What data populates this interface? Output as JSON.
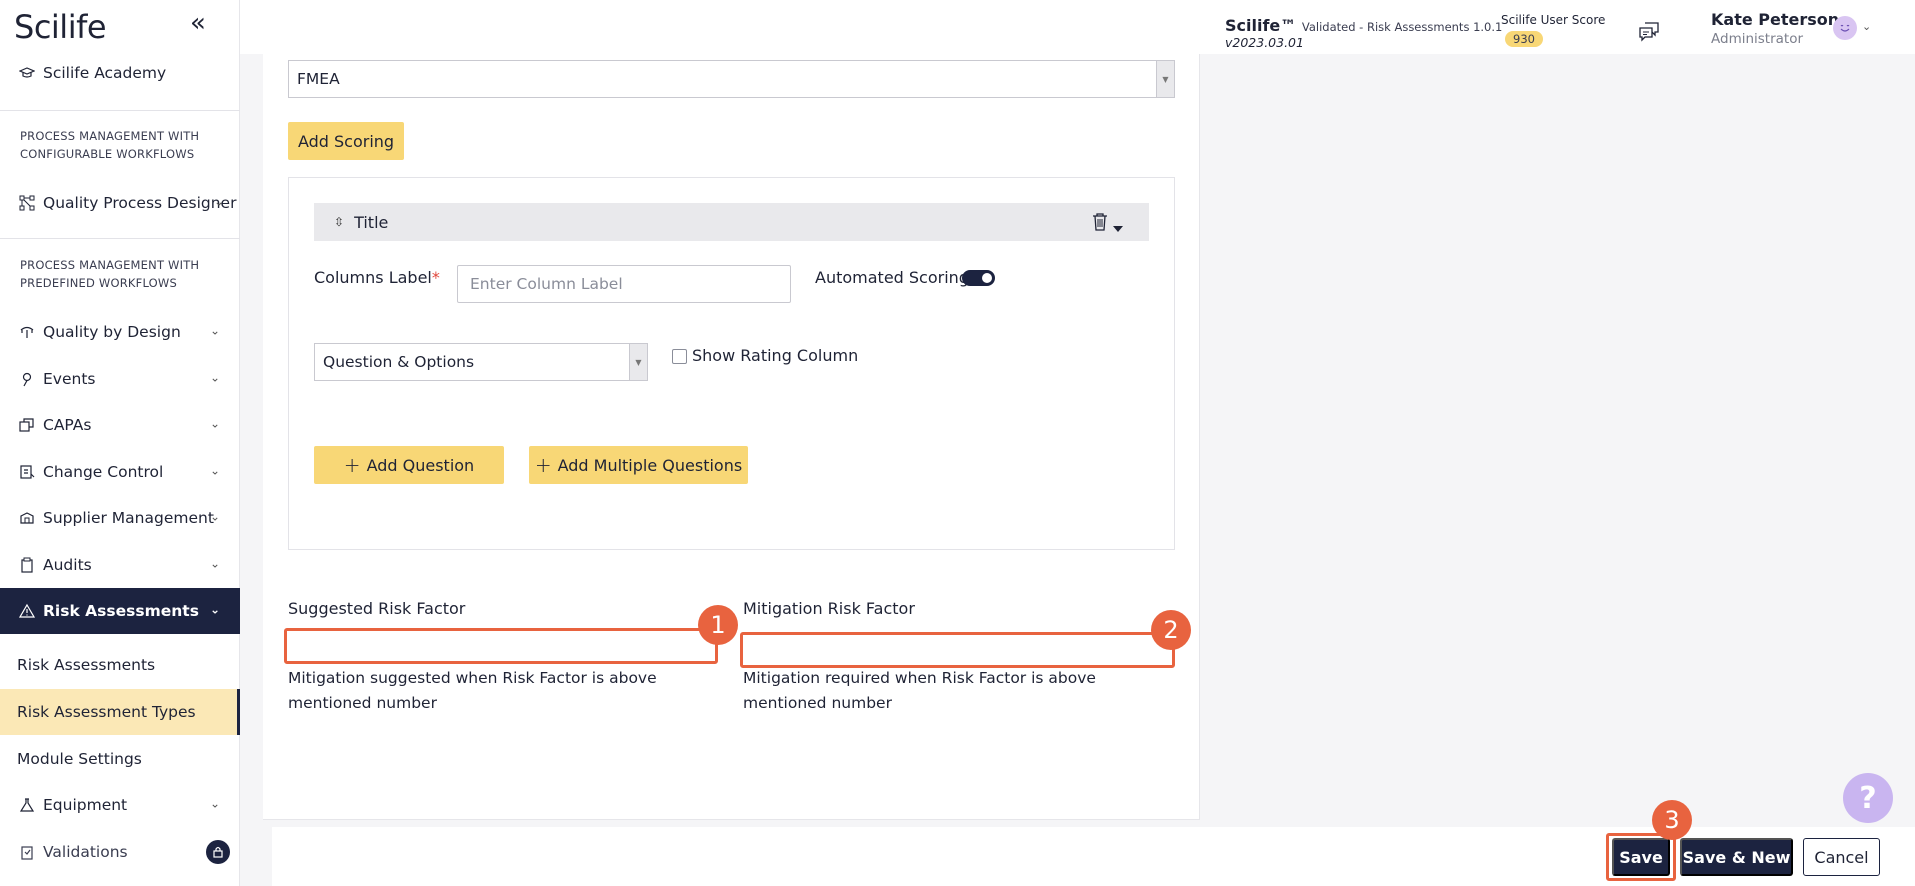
{
  "sidebar": {
    "logo": "Scilife",
    "academy": "Scilife Academy",
    "section_configurable": "PROCESS MANAGEMENT WITH CONFIGURABLE WORKFLOWS",
    "quality_process_designer": "Quality Process Designer",
    "section_predefined": "PROCESS MANAGEMENT WITH PREDEFINED WORKFLOWS",
    "items": {
      "quality_by_design": "Quality by Design",
      "events": "Events",
      "capas": "CAPAs",
      "change_control": "Change Control",
      "supplier_management": "Supplier Management",
      "audits": "Audits",
      "risk_assessments": "Risk Assessments",
      "equipment": "Equipment",
      "validations": "Validations"
    },
    "sub_items": {
      "risk_assessments": "Risk Assessments",
      "risk_assessment_types": "Risk Assessment Types",
      "module_settings": "Module Settings"
    }
  },
  "header": {
    "product": "Scilife™",
    "validated_text": "Validated - Risk Assessments 1.0.1",
    "version": "v2023.03.01",
    "score_label": "Scilife User Score",
    "score_value": "930",
    "user_name": "Kate Peterson",
    "user_role": "Administrator"
  },
  "form": {
    "method_select": "FMEA",
    "add_scoring_label": "Add Scoring",
    "scoring_title": "Title",
    "columns_label": "Columns Label",
    "required_mark": "*",
    "column_label_placeholder": "Enter Column Label",
    "automated_scoring_label": "Automated Scoring",
    "question_type_select": "Question & Options",
    "show_rating_label": "Show Rating Column",
    "add_question_label": "Add Question",
    "add_multiple_questions_label": "Add Multiple Questions",
    "suggested_risk_label": "Suggested Risk Factor",
    "suggested_risk_hint": "Mitigation suggested when Risk Factor is above mentioned number",
    "mitigation_risk_label": "Mitigation Risk Factor",
    "mitigation_risk_hint": "Mitigation required when Risk Factor is above mentioned number"
  },
  "markers": {
    "one": "1",
    "two": "2",
    "three": "3"
  },
  "footer": {
    "save_label": "Save",
    "save_new_label": "Save & New",
    "cancel_label": "Cancel"
  },
  "help_icon": "?",
  "colors": {
    "navy": "#1c2340",
    "accent_yellow": "#f8d776",
    "selected_bg": "#fbe8b6",
    "annotation_orange": "#e8633f",
    "help_purple": "#c9b5f0"
  },
  "icons": [
    "collapse-sidebar-icon",
    "academy-icon",
    "workflow-icon",
    "quality-design-icon",
    "events-icon",
    "capas-icon",
    "change-control-icon",
    "supplier-icon",
    "audits-icon",
    "warning-triangle-icon",
    "flask-icon",
    "clipboard-icon",
    "lock-icon",
    "chat-icon",
    "avatar-icon",
    "sort-icon",
    "trash-icon",
    "caret-down-icon",
    "plus-icon",
    "help-icon"
  ]
}
